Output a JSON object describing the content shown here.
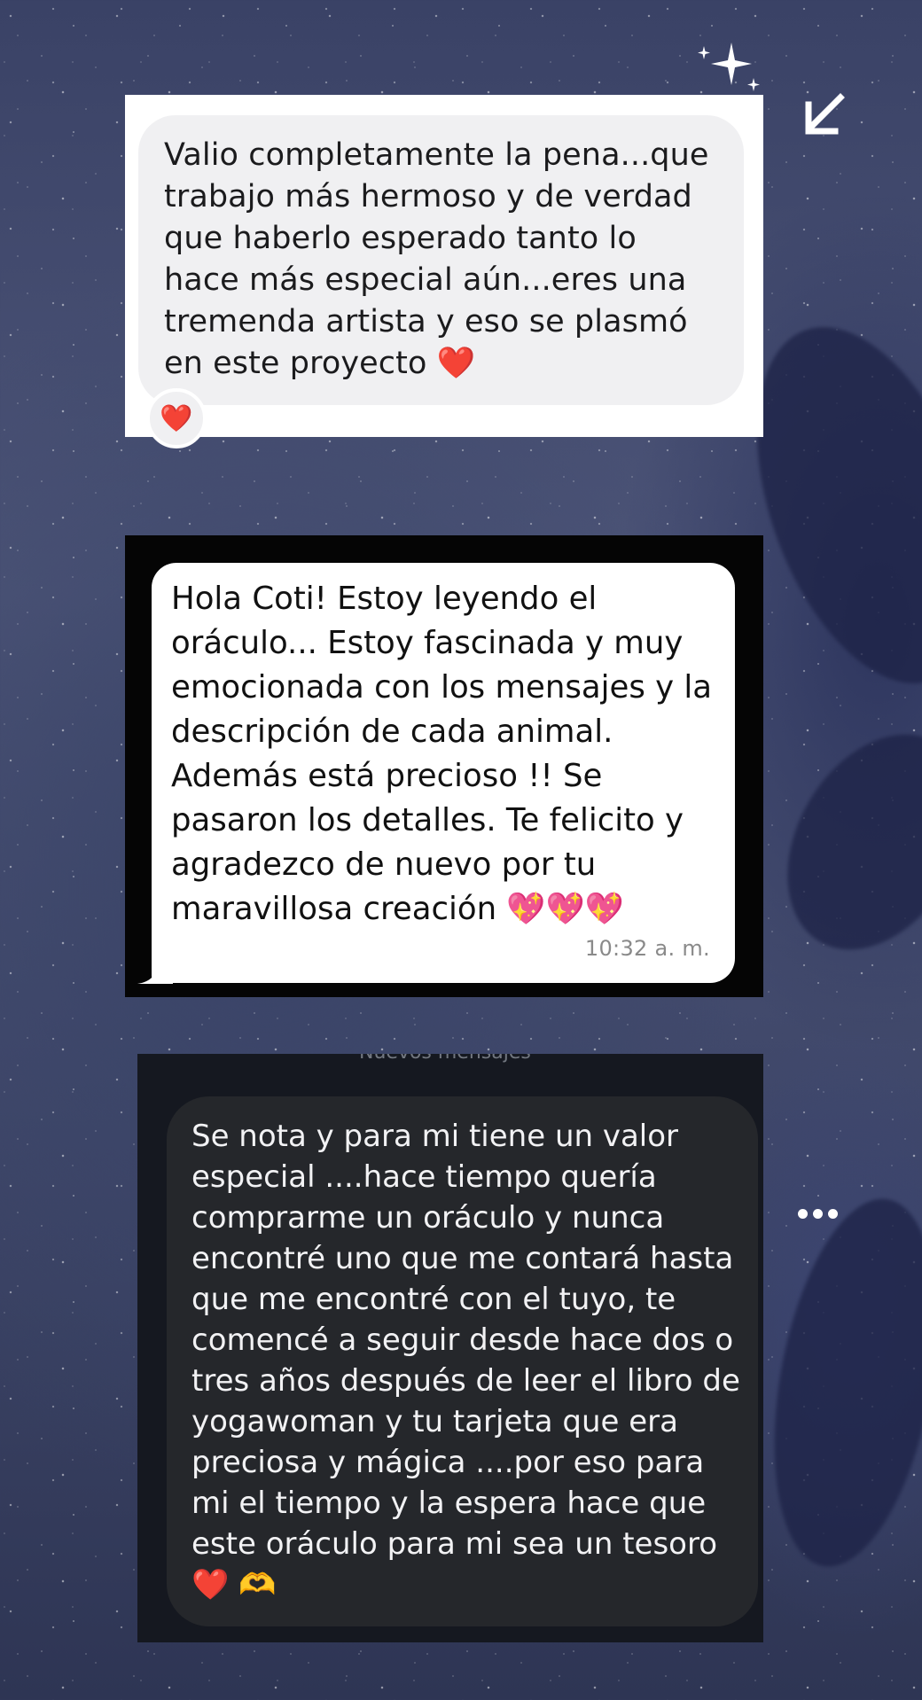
{
  "background": {
    "theme": "starry-night-whales",
    "sparkle_icon": "sparkle-icon",
    "corner_icon": "arrow-down-left-icon",
    "more_icon": "more-horizontal-icon"
  },
  "screenshots": [
    {
      "app_style": "light",
      "message": "Valio completamente la pena...que trabajo más hermoso y de verdad que haberlo esperado tanto lo hace más especial aún...eres una tremenda artista y eso se plasmó en este proyecto",
      "message_emoji": "❤️",
      "reaction": "❤️"
    },
    {
      "app_style": "whatsapp-light-on-dark",
      "message": "Hola Coti! Estoy leyendo el oráculo... Estoy fascinada y muy emocionada con los mensajes y la descripción de cada animal. Además está precioso !! Se pasaron los detalles. Te felicito y agradezco de nuevo por tu maravillosa creación",
      "message_emoji": "💖💖💖",
      "time": "10:32 a. m."
    },
    {
      "app_style": "dark",
      "cut_off_header": "Nuevos mensajes",
      "message": "Se nota y para mi tiene un valor especial ....hace tiempo quería comprarme un oráculo y nunca encontré uno que me contará hasta que me encontré con el tuyo, te comencé a seguir desde hace dos o tres años después de leer el libro de yogawoman y tu tarjeta que era preciosa y mágica ....por eso para mi el tiempo y la espera hace que este oráculo para mi sea un tesoro",
      "message_emoji": "❤️ 🫶"
    }
  ],
  "colors": {
    "bubble_light": "#f0f0f2",
    "bubble_white": "#ffffff",
    "bubble_dark": "#25272b",
    "timestamp": "#8a8a8a"
  }
}
